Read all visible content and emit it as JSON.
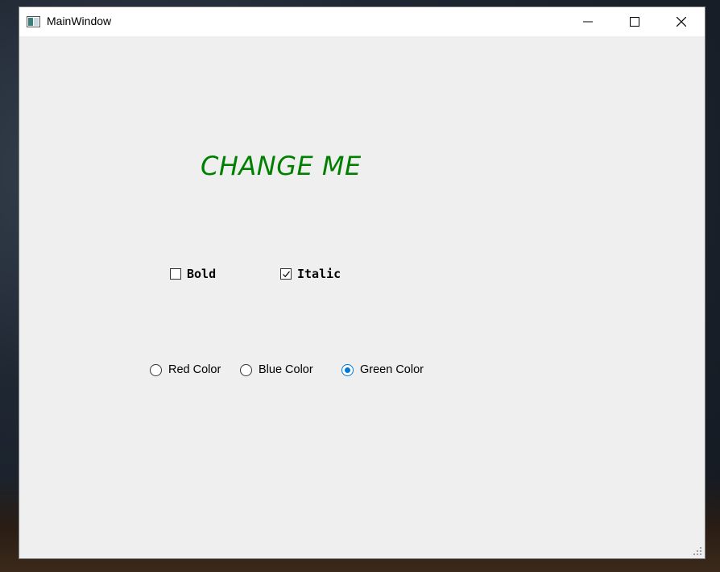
{
  "window": {
    "title": "MainWindow"
  },
  "label": {
    "text": "CHANGE ME",
    "color": "#008000",
    "italic": true
  },
  "checkboxes": [
    {
      "label": "Bold",
      "checked": false
    },
    {
      "label": "Italic",
      "checked": true
    }
  ],
  "radios": [
    {
      "label": "Red Color",
      "selected": false
    },
    {
      "label": "Blue Color",
      "selected": false
    },
    {
      "label": "Green Color",
      "selected": true
    }
  ],
  "colors": {
    "accent": "#0078d7",
    "label_green": "#008000"
  },
  "icons": [
    "app-window-icon",
    "minimize-icon",
    "maximize-icon",
    "close-icon",
    "size-grip-icon",
    "checkmark-icon"
  ]
}
